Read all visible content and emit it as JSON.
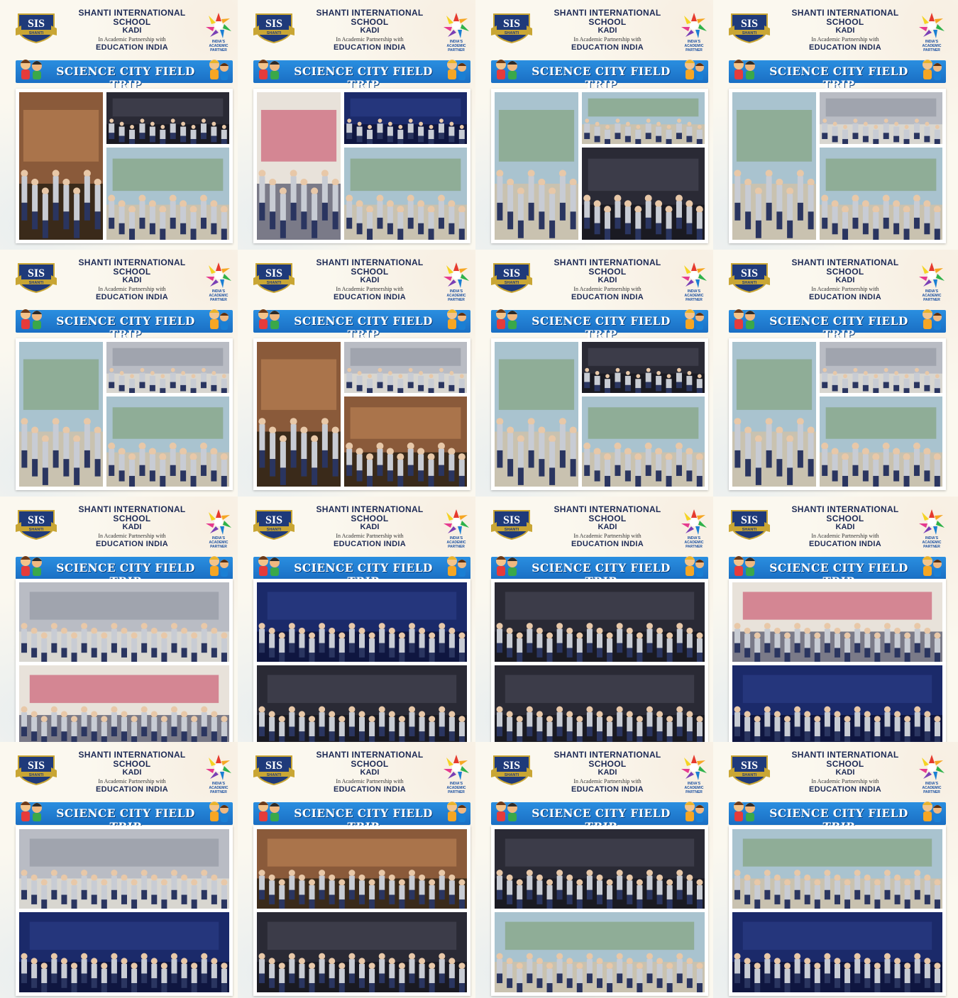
{
  "card": {
    "school_name": "SHANTI INTERNATIONAL SCHOOL",
    "location": "KADI",
    "partnership": "In Academic Partnership with",
    "partner": "EDUCATION INDIA",
    "partner_logo_text": "INDIA'S ACADEMIC PARTNER",
    "banner_title": "SCIENCE CITY FIELD TRIP",
    "sis_logo_text": "SIS",
    "sis_logo_sub": "SHANTI"
  },
  "colors": {
    "banner": "#1a6fc4",
    "school_text": "#1d2a55",
    "background": "#ece9e3"
  },
  "icons": [
    "sis-crest-icon",
    "education-india-logo-icon",
    "kids-left-icon",
    "kids-right-icon"
  ],
  "cards": [
    {
      "layout": "A",
      "photos": [
        "heart-model-exhibit",
        "students-group-dark-hall",
        "students-group-robot-courtyard"
      ]
    },
    {
      "layout": "A",
      "photos": [
        "students-line-by-bus",
        "students-group-aquarium",
        "students-group-outdoor-gate"
      ]
    },
    {
      "layout": "A",
      "photos": [
        "students-group-robot-statue",
        "students-group-courtyard",
        "students-seated-auditorium"
      ]
    },
    {
      "layout": "A",
      "photos": [
        "students-line-outdoor",
        "students-group-pool-hall",
        "students-group-robot-building"
      ]
    },
    {
      "layout": "A",
      "photos": [
        "students-walking-line",
        "students-in-exhibit-hall",
        "students-group-dinosaur"
      ]
    },
    {
      "layout": "A",
      "photos": [
        "students-colorful-structure",
        "students-group-museum",
        "students-table-exhibit"
      ]
    },
    {
      "layout": "A",
      "photos": [
        "students-queue-trees",
        "students-3d-theatre",
        "students-group-dinosaur-park"
      ]
    },
    {
      "layout": "A",
      "photos": [
        "students-cheering-robot",
        "students-group-pool-hall",
        "students-group-dinosaur"
      ]
    },
    {
      "layout": "B",
      "photos": [
        "students-seated-floor",
        "students-by-bus"
      ]
    },
    {
      "layout": "B",
      "photos": [
        "students-with-astronaut",
        "students-diorama-exhibit"
      ]
    },
    {
      "layout": "B",
      "photos": [
        "students-night-globe",
        "students-3d-theatre-bubbles"
      ]
    },
    {
      "layout": "B",
      "photos": [
        "students-by-gajanand-bus",
        "students-globe-hall"
      ]
    },
    {
      "layout": "B",
      "photos": [
        "students-group-dome",
        "students-world-map-wall"
      ]
    },
    {
      "layout": "B",
      "photos": [
        "students-touch-table",
        "students-seated-theatre"
      ]
    },
    {
      "layout": "B",
      "photos": [
        "students-group-stage",
        "students-waving-outdoor"
      ]
    },
    {
      "layout": "B",
      "photos": [
        "students-group-outdoor",
        "students-world-map-wall"
      ]
    }
  ]
}
